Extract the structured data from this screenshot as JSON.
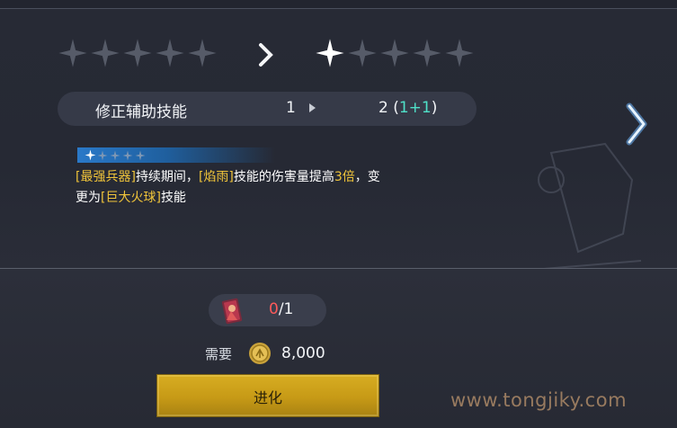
{
  "stars": {
    "current_filled": 0,
    "next_filled": 1,
    "total": 5
  },
  "skill": {
    "name": "修正辅助技能",
    "level_from": "1",
    "level_to_text": "2 (",
    "level_to_plus": "1+1",
    "level_to_close": ")"
  },
  "description": {
    "line1_a": "[最强兵器]",
    "line1_b": "持续期间，",
    "line1_c": "[焰雨]",
    "line1_d": "技能的伤害量提高",
    "line1_e": "3倍",
    "line1_f": "，变",
    "line2_a": "更为",
    "line2_b": "[巨大火球]",
    "line2_c": "技能"
  },
  "material": {
    "owned": "0",
    "required": "/1"
  },
  "cost": {
    "label": "需要",
    "amount": "8,000"
  },
  "evolve_button": {
    "label": "进化"
  },
  "watermark": "www.tongjiky.com",
  "colors": {
    "highlight": "#f0c43a",
    "plus": "#4fe0c8",
    "deficit": "#ff5a5a",
    "button": "#d7ad22"
  }
}
